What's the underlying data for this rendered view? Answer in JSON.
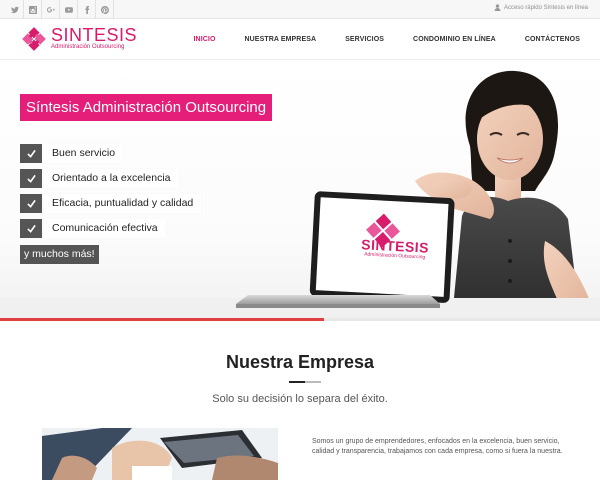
{
  "topbar": {
    "social": [
      "twitter-icon",
      "instagram-icon",
      "google-plus-icon",
      "youtube-icon",
      "facebook-icon",
      "pinterest-icon"
    ],
    "quick_access": "Acceso rápido Síntesis en línea"
  },
  "brand": {
    "name": "SINTESIS",
    "tagline": "Administración Outsourcing",
    "color": "#d81b6b"
  },
  "nav": {
    "items": [
      "INICIO",
      "NUESTRA EMPRESA",
      "SERVICIOS",
      "CONDOMINIO EN LÍNEA",
      "CONTÁCTENOS"
    ],
    "active": "INICIO"
  },
  "hero": {
    "title": "Síntesis Administración Outsourcing",
    "features": [
      "Buen servicio",
      "Orientado a la excelencia",
      "Eficacia, puntualidad y calidad",
      "Comunicación efectiva"
    ],
    "more": "y muchos más!",
    "laptop_logo": "SINTESIS",
    "laptop_tagline": "Administración Outsourcing",
    "accent": "#e41e79"
  },
  "slider": {
    "progress": 0.54
  },
  "about": {
    "title": "Nuestra Empresa",
    "subtitle": "Solo su decisión lo separa del éxito.",
    "text": "Somos un grupo de emprendedores, enfocados en la excelencia, buen servicio, calidad y transparencia, trabajamos con cada empresa, como si fuera la nuestra."
  }
}
